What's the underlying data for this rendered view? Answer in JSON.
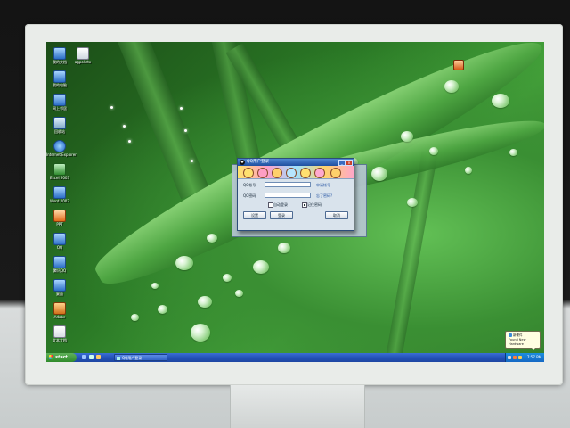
{
  "desktop": {
    "icons": [
      {
        "label": "我的文档",
        "icon": "documents-icon"
      },
      {
        "label": "我的电脑",
        "icon": "computer-icon"
      },
      {
        "label": "网上邻居",
        "icon": "network-icon"
      },
      {
        "label": "回收站",
        "icon": "recycle-bin-icon"
      },
      {
        "label": "Internet Explorer",
        "icon": "ie-icon"
      },
      {
        "label": "Excel 2003",
        "icon": "excel-icon"
      },
      {
        "label": "Word 2003",
        "icon": "word-icon"
      },
      {
        "label": "PPT",
        "icon": "powerpoint-icon"
      },
      {
        "label": "QQ",
        "icon": "qq-icon"
      },
      {
        "label": "腾讯QQ",
        "icon": "qq-penguin-icon"
      },
      {
        "label": "桌面",
        "icon": "desktop-icon"
      },
      {
        "label": "Adobe",
        "icon": "adobe-icon"
      },
      {
        "label": "文本文档",
        "icon": "text-file-icon"
      }
    ],
    "top_icon_2_label": "agpollctx"
  },
  "qq_dialog": {
    "title": "QQ用户登录",
    "account_label": "QQ帐号",
    "account_value": "",
    "register_link": "申请帐号",
    "password_label": "QQ密码",
    "forgot_link": "忘了密码?",
    "auto_login_label": "自动登录",
    "remember_label": "记住密码",
    "settings_button": "设置",
    "login_button": "登录",
    "cancel_button": "取消"
  },
  "taskbar": {
    "start_label": "start",
    "active_task": "QQ用户登录",
    "clock": "7:57 PM"
  },
  "balloon": {
    "title": "新硬件",
    "text": "Found New Hardware"
  },
  "colors": {
    "taskbar_blue": "#2452b8",
    "start_green": "#2f8a2b",
    "wallpaper_green": "#3a8f33"
  }
}
